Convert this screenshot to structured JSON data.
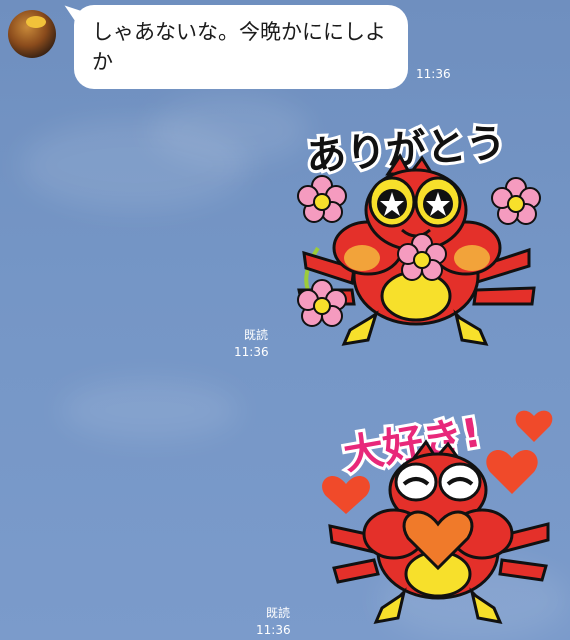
{
  "chat": {
    "incoming": {
      "message": "しゃあないな。今晩かににしよか",
      "time": "11:36"
    },
    "sticker1": {
      "caption": "ありがとう",
      "read_label": "既読",
      "time": "11:36"
    },
    "sticker2": {
      "caption": "大好き!",
      "read_label": "既読",
      "time": "11:36"
    }
  },
  "colors": {
    "background": "#7596c6",
    "bubble": "#ffffff",
    "crab_red": "#e4302a",
    "crab_yellow": "#f7e02b",
    "flower_pink": "#f59bbf",
    "heart_red": "#f04a2a",
    "daisuki_pink": "#e8287a"
  }
}
